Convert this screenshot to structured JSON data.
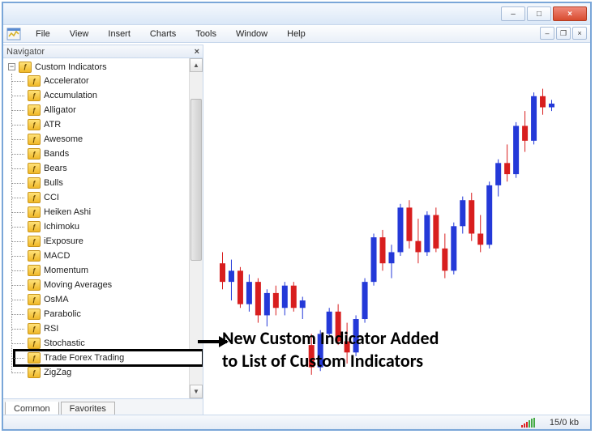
{
  "window_controls": {
    "minimize": "–",
    "maximize": "□",
    "close": "×"
  },
  "menubar": [
    "File",
    "View",
    "Insert",
    "Charts",
    "Tools",
    "Window",
    "Help"
  ],
  "doc_controls": {
    "minimize": "–",
    "restore": "❐",
    "close": "×"
  },
  "navigator": {
    "title": "Navigator",
    "root": "Custom Indicators",
    "items": [
      "Accelerator",
      "Accumulation",
      "Alligator",
      "ATR",
      "Awesome",
      "Bands",
      "Bears",
      "Bulls",
      "CCI",
      "Heiken Ashi",
      "Ichimoku",
      "iExposure",
      "MACD",
      "Momentum",
      "Moving Averages",
      "OsMA",
      "Parabolic",
      "RSI",
      "Stochastic",
      "Trade Forex Trading",
      "ZigZag"
    ],
    "highlighted_index": 19,
    "tabs": [
      "Common",
      "Favorites"
    ],
    "active_tab": 0
  },
  "annotation": {
    "line1": "New Custom Indicator Added",
    "line2": "to List of Custom Indicators"
  },
  "statusbar": {
    "traffic": "15/0 kb"
  },
  "chart_data": {
    "type": "candlestick",
    "note": "Approximate values read off an unlabeled MT4 candlestick chart. Prices are relative units (no visible axis).",
    "candles": [
      {
        "o": 52,
        "h": 55,
        "l": 45,
        "c": 47,
        "color": "red"
      },
      {
        "o": 47,
        "h": 53,
        "l": 42,
        "c": 50,
        "color": "blue"
      },
      {
        "o": 50,
        "h": 51,
        "l": 40,
        "c": 41,
        "color": "red"
      },
      {
        "o": 41,
        "h": 49,
        "l": 39,
        "c": 47,
        "color": "blue"
      },
      {
        "o": 47,
        "h": 48,
        "l": 36,
        "c": 38,
        "color": "red"
      },
      {
        "o": 38,
        "h": 45,
        "l": 35,
        "c": 44,
        "color": "blue"
      },
      {
        "o": 44,
        "h": 46,
        "l": 38,
        "c": 40,
        "color": "red"
      },
      {
        "o": 40,
        "h": 47,
        "l": 38,
        "c": 46,
        "color": "blue"
      },
      {
        "o": 46,
        "h": 47,
        "l": 39,
        "c": 40,
        "color": "red"
      },
      {
        "o": 40,
        "h": 43,
        "l": 37,
        "c": 42,
        "color": "blue"
      },
      {
        "o": 30,
        "h": 33,
        "l": 22,
        "c": 24,
        "color": "red"
      },
      {
        "o": 24,
        "h": 34,
        "l": 23,
        "c": 33,
        "color": "blue"
      },
      {
        "o": 33,
        "h": 40,
        "l": 32,
        "c": 39,
        "color": "blue"
      },
      {
        "o": 39,
        "h": 41,
        "l": 30,
        "c": 31,
        "color": "red"
      },
      {
        "o": 31,
        "h": 36,
        "l": 25,
        "c": 28,
        "color": "red"
      },
      {
        "o": 28,
        "h": 38,
        "l": 27,
        "c": 37,
        "color": "blue"
      },
      {
        "o": 37,
        "h": 48,
        "l": 36,
        "c": 47,
        "color": "blue"
      },
      {
        "o": 47,
        "h": 60,
        "l": 46,
        "c": 59,
        "color": "blue"
      },
      {
        "o": 59,
        "h": 61,
        "l": 50,
        "c": 52,
        "color": "red"
      },
      {
        "o": 52,
        "h": 57,
        "l": 48,
        "c": 55,
        "color": "blue"
      },
      {
        "o": 55,
        "h": 68,
        "l": 54,
        "c": 67,
        "color": "blue"
      },
      {
        "o": 67,
        "h": 69,
        "l": 56,
        "c": 58,
        "color": "red"
      },
      {
        "o": 58,
        "h": 64,
        "l": 52,
        "c": 55,
        "color": "red"
      },
      {
        "o": 55,
        "h": 66,
        "l": 54,
        "c": 65,
        "color": "blue"
      },
      {
        "o": 65,
        "h": 67,
        "l": 55,
        "c": 56,
        "color": "red"
      },
      {
        "o": 56,
        "h": 60,
        "l": 48,
        "c": 50,
        "color": "red"
      },
      {
        "o": 50,
        "h": 63,
        "l": 49,
        "c": 62,
        "color": "blue"
      },
      {
        "o": 62,
        "h": 70,
        "l": 60,
        "c": 69,
        "color": "blue"
      },
      {
        "o": 69,
        "h": 71,
        "l": 58,
        "c": 60,
        "color": "red"
      },
      {
        "o": 60,
        "h": 65,
        "l": 55,
        "c": 57,
        "color": "red"
      },
      {
        "o": 57,
        "h": 74,
        "l": 56,
        "c": 73,
        "color": "blue"
      },
      {
        "o": 73,
        "h": 80,
        "l": 70,
        "c": 79,
        "color": "blue"
      },
      {
        "o": 79,
        "h": 84,
        "l": 74,
        "c": 76,
        "color": "red"
      },
      {
        "o": 76,
        "h": 90,
        "l": 75,
        "c": 89,
        "color": "blue"
      },
      {
        "o": 89,
        "h": 93,
        "l": 82,
        "c": 85,
        "color": "red"
      },
      {
        "o": 85,
        "h": 98,
        "l": 84,
        "c": 97,
        "color": "blue"
      },
      {
        "o": 97,
        "h": 99,
        "l": 92,
        "c": 94,
        "color": "red"
      },
      {
        "o": 94,
        "h": 96,
        "l": 93,
        "c": 95,
        "color": "blue"
      }
    ]
  }
}
